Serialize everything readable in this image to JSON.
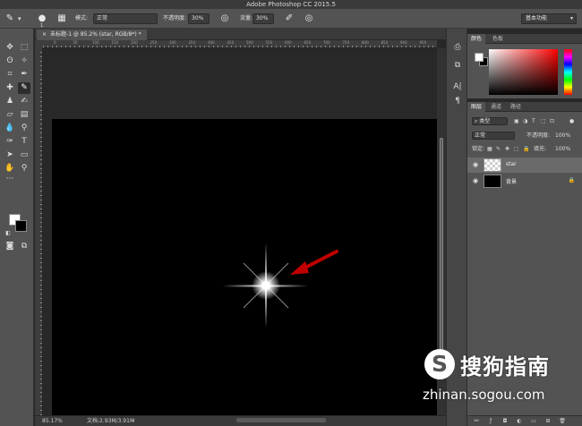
{
  "window": {
    "title": "Adobe Photoshop CC 2015.5"
  },
  "options_bar": {
    "brush_size": "1",
    "mode_label": "模式:",
    "mode_value": "正常",
    "opacity_label": "不透明度:",
    "opacity_value": "30%",
    "flow_label": "流量:",
    "flow_value": "30%",
    "workspace_value": "基本功能"
  },
  "document": {
    "tab_label": "未标题-1 @ 85.2% (star, RGB/8*) *",
    "zoom_status": "85.17%",
    "doc_size": "文档:2.93M/3.91M"
  },
  "ruler_ticks": [
    "0",
    "50",
    "100",
    "150",
    "200",
    "250",
    "300",
    "350",
    "400",
    "450",
    "500",
    "550",
    "600",
    "650",
    "700",
    "750",
    "800",
    "850",
    "900",
    "950"
  ],
  "panels": {
    "color_tabs": [
      "颜色",
      "色板"
    ],
    "layers_tabs": [
      "图层",
      "通道",
      "路径"
    ],
    "filter_kind": "类型",
    "blend_mode": "正常",
    "opacity_label": "不透明度:",
    "opacity_value": "100%",
    "lock_label": "锁定:",
    "fill_label": "填充:",
    "fill_value": "100%",
    "layers": [
      {
        "name": "star",
        "selected": true
      },
      {
        "name": "背景",
        "selected": false
      }
    ]
  },
  "watermark": {
    "brand": "搜狗指南",
    "url": "zhinan.sogou.com"
  },
  "colors": {
    "accent_arrow": "#c00000",
    "canvas": "#000000"
  }
}
